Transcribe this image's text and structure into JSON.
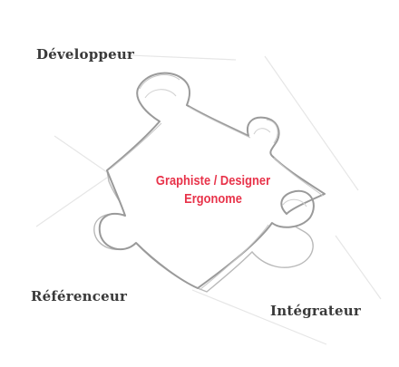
{
  "diagram": {
    "center_piece": {
      "line1": "Graphiste / Designer",
      "line2": "Ergonome",
      "text_color": "#e8334a"
    },
    "roles": {
      "top_left": "Développeur",
      "bottom_left": "Référenceur",
      "bottom_right": "Intégrateur"
    },
    "stroke_color": "#9a9a9a",
    "icon": "puzzle-piece-sketch"
  }
}
